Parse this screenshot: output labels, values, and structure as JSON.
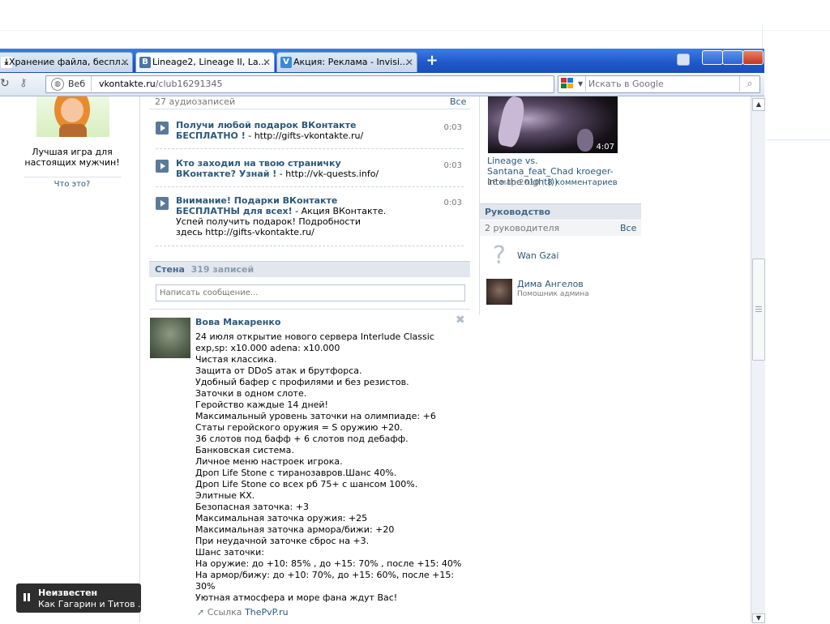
{
  "browser": {
    "tabs": [
      {
        "label": "Хранение файла, беспл..."
      },
      {
        "label": "Lineage2, Lineage II, La..."
      },
      {
        "label": "Акция: Реклама - Invisi..."
      }
    ],
    "web_label": "Веб",
    "url_host": "vkontakte.ru",
    "url_path": "/club16291345",
    "search_placeholder": "Искать в Google"
  },
  "left_ad": {
    "caption": "Лучшая игра для настоящих мужчин!",
    "link": "Что это?"
  },
  "audio": {
    "count_label": "27 аудиозаписей",
    "all_link": "Все",
    "items": [
      {
        "title": "Получи любой подарок ВКонтакте БЕСПЛАТНО !",
        "rest": " - http://gifts-vkontakte.ru/",
        "duration": "0:03"
      },
      {
        "title": "Кто заходил на твою страничку ВКонтакте? Узнай !",
        "rest": " - http://vk-quests.info/",
        "duration": "0:03"
      },
      {
        "title": "Внимание! Подарки ВКонтакте БЕСПЛАТНЫ для всех!",
        "rest": " - Акция ВКонтакте. Успей получить подарок! Подробности здесь http://gifts-vkontakte.ru/",
        "duration": "0:03"
      }
    ]
  },
  "wall": {
    "title": "Стена",
    "count": "319 записей",
    "input_placeholder": "Написать сообщение...",
    "post": {
      "author": "Вова Макаренко",
      "lines": [
        "24 июля открытие нового сервера Interlude Classic",
        "exp,sp: x10.000 adena: x10.000",
        "Чистая классика.",
        "Защита от DDoS атак и брутфорса.",
        "Удобный бафер с профилями и без резистов.",
        "Заточки в одном слоте.",
        "Геройство каждые 14 дней!",
        "Максимальный уровень заточки на олимпиаде: +6",
        "Статы геройского оружия = S оружию +20.",
        "36 слотов под бафф + 6 слотов под дебафф.",
        "Банковская система.",
        "Личное меню настроек игрока.",
        "Дроп Life Stone с тиранозавров.Шанс 40%.",
        "Дроп Life Stone со всех рб 75+ с шансом 100%.",
        "Элитные КХ.",
        "Безопасная заточка: +3",
        "Максимальная заточка оружия: +25",
        "Максимальная заточка армора/бижи: +20",
        "При неудачной заточке сброс на +3.",
        "Шанс заточки:",
        "На оружие: до +10: 85% , до +15: 70% , после +15: 40%",
        "На армор/бижу: до +10: 70%, до +15: 60%, после +15: 30%",
        "",
        "Уютная атмосфера и море фана ждут Вас!"
      ],
      "link_prefix": "Ссылка",
      "link_text": "ThePvP.ru"
    }
  },
  "video": {
    "duration": "4:07",
    "title": "Lineage vs. Santana_feat_Chad kroeger-into the night)))",
    "date": "16 мар 2010",
    "comments": "8 комментариев"
  },
  "leaders": {
    "title": "Руководство",
    "count_label": "2 руководителя",
    "all_link": "Все",
    "items": [
      {
        "name": "Wan Gzai",
        "role": ""
      },
      {
        "name": "Дима Ангелов",
        "role": "Помошник админа"
      }
    ]
  },
  "player": {
    "artist": "Неизвестен",
    "track": "Как Гагарин и Титов ..."
  },
  "colors": {
    "vk_link": "#2b587a",
    "section_bg": "#e1e7ed",
    "tabbar_blue": "#1f57c9"
  }
}
